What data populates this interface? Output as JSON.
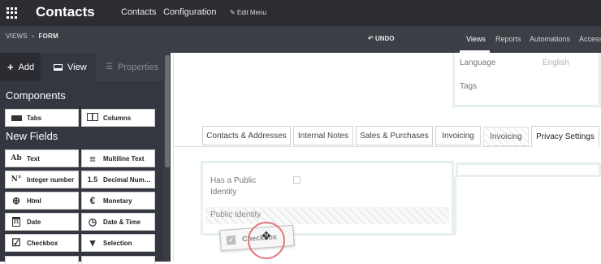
{
  "topbar": {
    "app_title": "Contacts",
    "links": [
      "Contacts",
      "Configuration"
    ],
    "edit_menu": "✎ Edit Menu"
  },
  "subbar": {
    "breadcrumb": {
      "first": "VIEWS",
      "separator": "›",
      "second": "FORM"
    },
    "undo": "UNDO",
    "tabs": [
      "Views",
      "Reports",
      "Automations",
      "Access"
    ],
    "active_tab": "Views"
  },
  "sidebar": {
    "tabs": {
      "add": "Add",
      "view": "View",
      "properties": "Properties"
    },
    "components_heading": "Components",
    "components": [
      {
        "label": "Tabs",
        "icon": "tabs-icon"
      },
      {
        "label": "Columns",
        "icon": "columns-icon"
      }
    ],
    "new_fields_heading": "New Fields",
    "fields": [
      {
        "label": "Text",
        "icon": "text-icon",
        "glyph": "Ab"
      },
      {
        "label": "Multiline Text",
        "icon": "multiline-text-icon",
        "glyph": "≡"
      },
      {
        "label": "Integer number",
        "icon": "integer-icon",
        "glyph": "N°"
      },
      {
        "label": "Decimal Num…",
        "icon": "decimal-icon",
        "glyph": "1.5"
      },
      {
        "label": "Html",
        "icon": "html-icon",
        "glyph": "⊕"
      },
      {
        "label": "Monetary",
        "icon": "monetary-icon",
        "glyph": "€"
      },
      {
        "label": "Date",
        "icon": "date-icon",
        "glyph": "21"
      },
      {
        "label": "Date & Time",
        "icon": "datetime-icon",
        "glyph": "◷"
      },
      {
        "label": "Checkbox",
        "icon": "checkbox-icon",
        "glyph": "☑"
      },
      {
        "label": "Selection",
        "icon": "selection-icon",
        "glyph": "▾"
      }
    ]
  },
  "form": {
    "language_label": "Language",
    "language_value": "English",
    "tags_label": "Tags",
    "notebook_tabs": [
      {
        "label": "Contacts & Addresses",
        "state": "normal"
      },
      {
        "label": "Internal Notes",
        "state": "normal"
      },
      {
        "label": "Sales & Purchases",
        "state": "normal"
      },
      {
        "label": "Invoicing",
        "state": "normal"
      },
      {
        "label": "Invoicing",
        "state": "ghost"
      },
      {
        "label": "Privacy Settings",
        "state": "active"
      }
    ],
    "public_identity_label": "Has a Public Identity",
    "public_identity_line1": "Has a Public",
    "public_identity_line2": "Identity",
    "public_identity_field": "Public Identity"
  },
  "drag": {
    "chip_label": "Checkbox",
    "cursor": "✥"
  },
  "colors": {
    "topbar": "#2b2d33",
    "subbar": "#3c3f45",
    "sidebar": "#343740",
    "drop_outline": "#e6f1ef",
    "cursor_ring": "#e0797c"
  }
}
